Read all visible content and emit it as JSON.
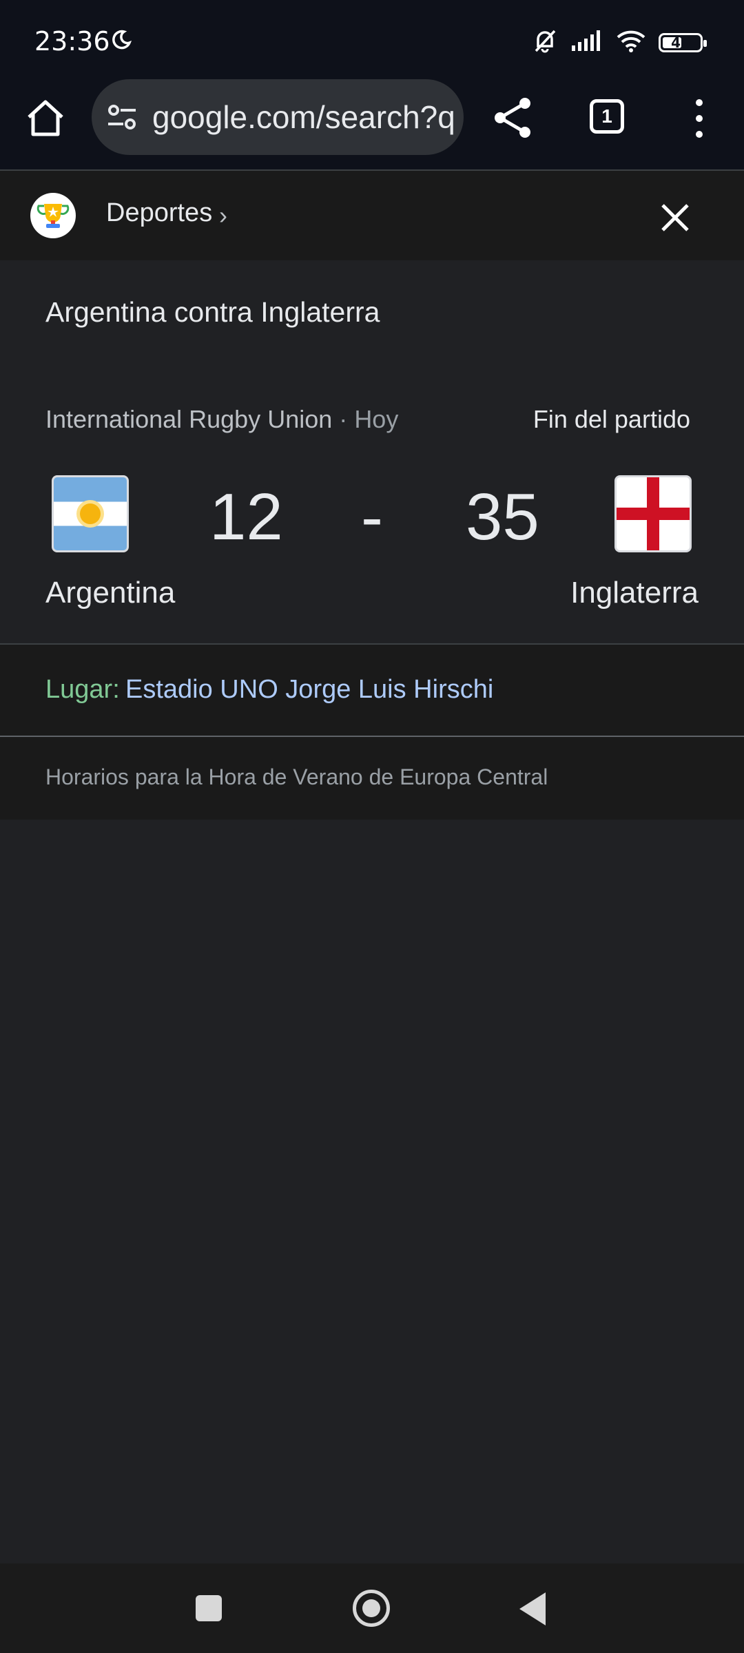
{
  "status_bar": {
    "time": "23:36",
    "battery": "46",
    "icons": [
      "moon-icon",
      "bell-off-icon",
      "signal-icon",
      "wifi-icon",
      "battery-icon"
    ]
  },
  "browser": {
    "url": "google.com/search?q",
    "tab_count": "1",
    "icons": [
      "home-icon",
      "tune-icon",
      "share-icon",
      "tabs-icon",
      "more-vert-icon"
    ]
  },
  "sheet": {
    "category": "Deportes",
    "icons": [
      "trophy-icon",
      "chevron-right-icon",
      "close-icon"
    ]
  },
  "match": {
    "title": "Argentina contra Inglaterra",
    "competition": "International Rugby Union",
    "separator": "·",
    "day": "Hoy",
    "status": "Fin del partido",
    "home": {
      "name": "Argentina",
      "score": "12"
    },
    "away": {
      "name": "Inglaterra",
      "score": "35"
    },
    "score_separator": "-",
    "venue_label": "Lugar:",
    "venue": "Estadio UNO Jorge Luis Hirschi",
    "timezone_note": "Horarios para la Hora de Verano de Europa Central"
  },
  "colors": {
    "background": "#202124",
    "venue_label": "#81c995",
    "link": "#aecbfa",
    "england_red": "#ce1124",
    "argentina_blue": "#74acdf"
  }
}
